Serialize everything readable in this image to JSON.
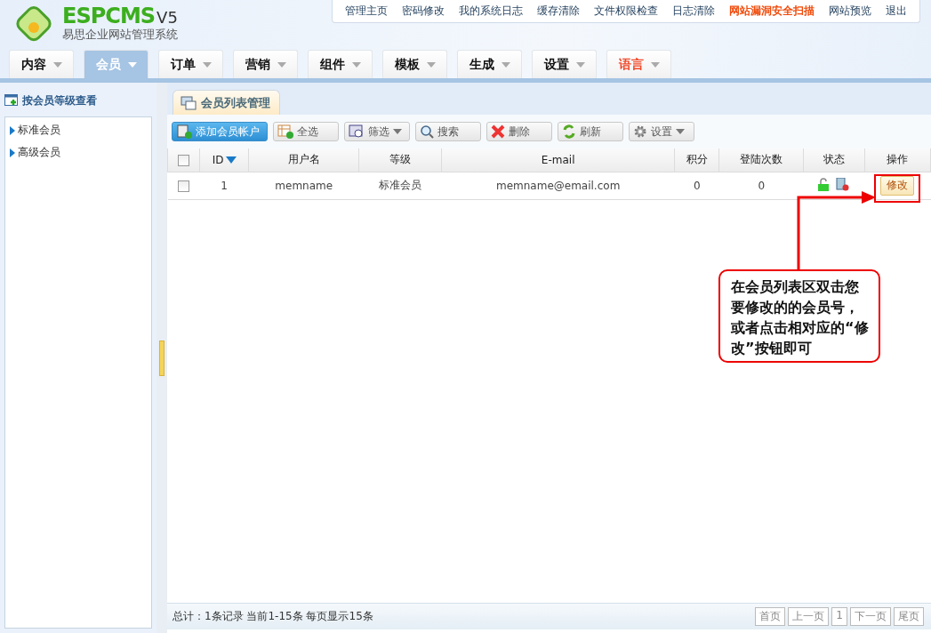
{
  "logo": {
    "brand": "ESPCMS",
    "version": "V5",
    "subtitle": "易思企业网站管理系统"
  },
  "top_links": [
    {
      "label": "管理主页",
      "highlight": false
    },
    {
      "label": "密码修改",
      "highlight": false
    },
    {
      "label": "我的系统日志",
      "highlight": false
    },
    {
      "label": "缓存清除",
      "highlight": false
    },
    {
      "label": "文件权限检查",
      "highlight": false
    },
    {
      "label": "日志清除",
      "highlight": false
    },
    {
      "label": "网站漏洞安全扫描",
      "highlight": true
    },
    {
      "label": "网站预览",
      "highlight": false
    },
    {
      "label": "退出",
      "highlight": false
    }
  ],
  "nav_tabs": [
    {
      "label": "内容",
      "selected": false,
      "highlight": false
    },
    {
      "label": "会员",
      "selected": true,
      "highlight": false
    },
    {
      "label": "订单",
      "selected": false,
      "highlight": false
    },
    {
      "label": "营销",
      "selected": false,
      "highlight": false
    },
    {
      "label": "组件",
      "selected": false,
      "highlight": false
    },
    {
      "label": "模板",
      "selected": false,
      "highlight": false
    },
    {
      "label": "生成",
      "selected": false,
      "highlight": false
    },
    {
      "label": "设置",
      "selected": false,
      "highlight": false
    },
    {
      "label": "语言",
      "selected": false,
      "highlight": true
    }
  ],
  "sidebar": {
    "title": "按会员等级查看",
    "items": [
      "标准会员",
      "高级会员"
    ]
  },
  "panel_tab": "会员列表管理",
  "toolbar": [
    {
      "label": "添加会员帐户",
      "kind": "primary",
      "dropdown": false
    },
    {
      "label": "全选",
      "kind": "normal",
      "dropdown": false
    },
    {
      "label": "筛选",
      "kind": "normal",
      "dropdown": true
    },
    {
      "label": "搜索",
      "kind": "normal",
      "dropdown": false
    },
    {
      "label": "删除",
      "kind": "normal",
      "dropdown": false
    },
    {
      "label": "刷新",
      "kind": "normal",
      "dropdown": false
    },
    {
      "label": "设置",
      "kind": "normal",
      "dropdown": true
    }
  ],
  "table": {
    "header_checked": false,
    "columns": [
      "ID",
      "用户名",
      "等级",
      "E-mail",
      "积分",
      "登陆次数",
      "状态",
      "操作"
    ],
    "rows": [
      {
        "checked": false,
        "id": "1",
        "username": "memname",
        "level": "标准会员",
        "email": "memname@email.com",
        "points": "0",
        "logins": "0",
        "action": "修改"
      }
    ]
  },
  "footer": {
    "summary": "总计：1条记录 当前1-15条 每页显示15条",
    "pager": [
      "首页",
      "上一页",
      "1",
      "下一页",
      "尾页"
    ]
  },
  "annotation": "在会员列表区双击您要修改的的会员号，或者点击相对应的“修改”按钮即可"
}
